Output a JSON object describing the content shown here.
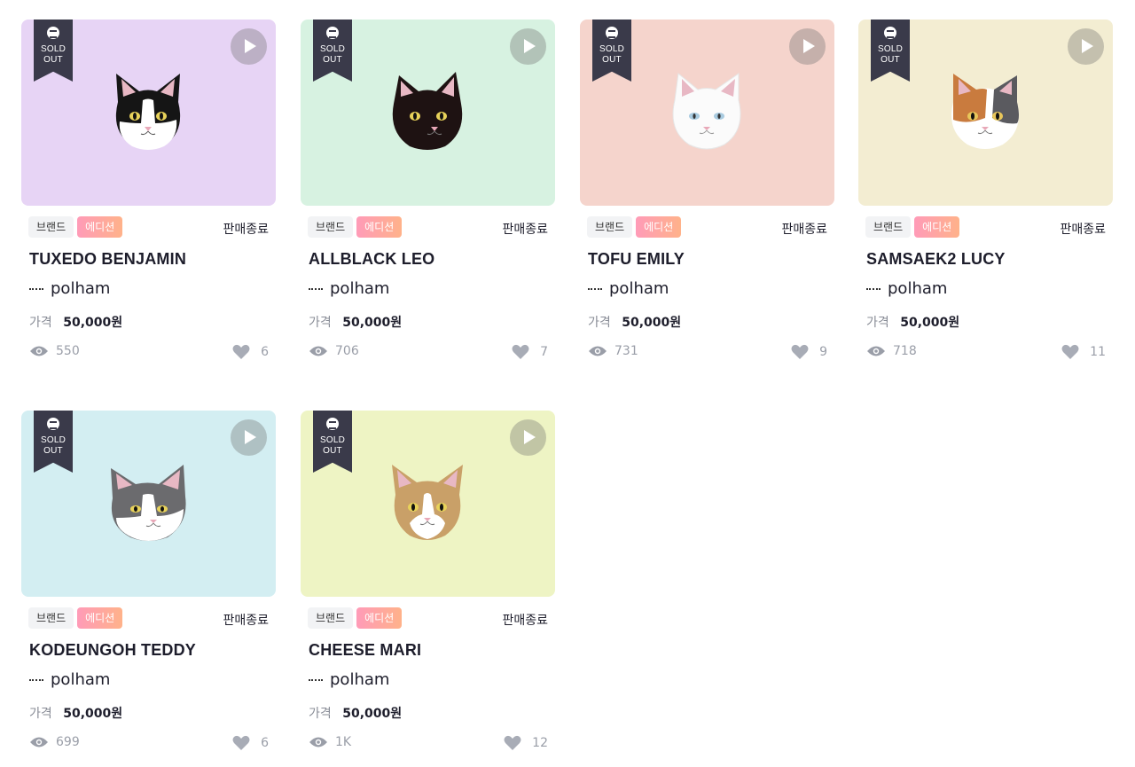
{
  "cards": [
    {
      "title": "TUXEDO BENJAMIN",
      "creator": "polham",
      "tag_brand": "브랜드",
      "tag_edition": "에디션",
      "status": "판매종료",
      "price_label": "가격",
      "price": "50,000원",
      "views": "550",
      "likes": "6",
      "ribbon": "SOLD OUT",
      "bg": "#e7d4f5",
      "cat": "tuxedo"
    },
    {
      "title": "ALLBLACK LEO",
      "creator": "polham",
      "tag_brand": "브랜드",
      "tag_edition": "에디션",
      "status": "판매종료",
      "price_label": "가격",
      "price": "50,000원",
      "views": "706",
      "likes": "7",
      "ribbon": "SOLD OUT",
      "bg": "#d7f2e1",
      "cat": "black"
    },
    {
      "title": "TOFU EMILY",
      "creator": "polham",
      "tag_brand": "브랜드",
      "tag_edition": "에디션",
      "status": "판매종료",
      "price_label": "가격",
      "price": "50,000원",
      "views": "731",
      "likes": "9",
      "ribbon": "SOLD OUT",
      "bg": "#f5d4cc",
      "cat": "white"
    },
    {
      "title": "SAMSAEK2 LUCY",
      "creator": "polham",
      "tag_brand": "브랜드",
      "tag_edition": "에디션",
      "status": "판매종료",
      "price_label": "가격",
      "price": "50,000원",
      "views": "718",
      "likes": "11",
      "ribbon": "SOLD OUT",
      "bg": "#f3edd2",
      "cat": "calico"
    },
    {
      "title": "KODEUNGOH TEDDY",
      "creator": "polham",
      "tag_brand": "브랜드",
      "tag_edition": "에디션",
      "status": "판매종료",
      "price_label": "가격",
      "price": "50,000원",
      "views": "699",
      "likes": "6",
      "ribbon": "SOLD OUT",
      "bg": "#d3eef2",
      "cat": "grey"
    },
    {
      "title": "CHEESE MARI",
      "creator": "polham",
      "tag_brand": "브랜드",
      "tag_edition": "에디션",
      "status": "판매종료",
      "price_label": "가격",
      "price": "50,000원",
      "views": "1K",
      "likes": "12",
      "ribbon": "SOLD OUT",
      "bg": "#eef4c4",
      "cat": "cheese"
    }
  ]
}
